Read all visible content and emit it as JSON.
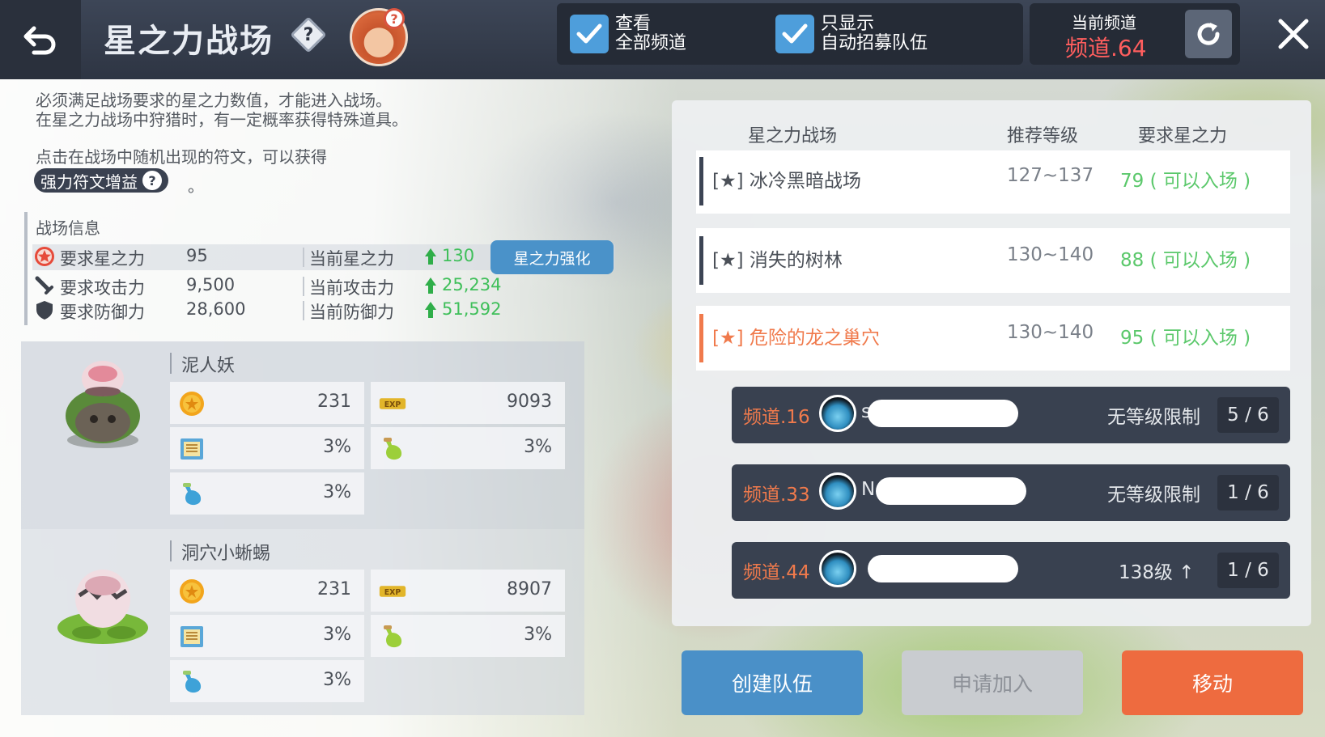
{
  "header": {
    "title": "星之力战场",
    "help_mark": "?",
    "mascot_badge": "?",
    "filter_all_line1": "查看",
    "filter_all_line2": "全部频道",
    "filter_recruit_line1": "只显示",
    "filter_recruit_line2": "自动招募队伍",
    "current_channel_caption": "当前频道",
    "current_channel_value": "频道.64",
    "filter_all_checked": true,
    "filter_recruit_checked": true
  },
  "info": {
    "desc_line1": "必须满足战场要求的星之力数值，才能进入战场。",
    "desc_line2": "在星之力战场中狩猎时，有一定概率获得特殊道具。",
    "rune_line": "点击在战场中随机出现的符文，可以获得",
    "rune_pill": "强力符文增益",
    "rune_pill_q": "?",
    "rune_end": "。"
  },
  "battle_info": {
    "title": "战场信息",
    "stats": [
      {
        "icon": "star-force-icon",
        "label": "要求星之力",
        "required": "95",
        "current_label": "当前星之力",
        "current": "130"
      },
      {
        "icon": "sword-icon",
        "label": "要求攻击力",
        "required": "9,500",
        "current_label": "当前攻击力",
        "current": "25,234"
      },
      {
        "icon": "shield-icon",
        "label": "要求防御力",
        "required": "28,600",
        "current_label": "当前防御力",
        "current": "51,592"
      }
    ],
    "enhance_button": "星之力强化"
  },
  "monsters": [
    {
      "name": "泥人妖",
      "drops": [
        {
          "icon": "meso-coin-icon",
          "value": "231"
        },
        {
          "icon": "exp-icon",
          "value": "9093"
        },
        {
          "icon": "scroll-icon",
          "value": "3%"
        },
        {
          "icon": "potion-green-icon",
          "value": "3%"
        },
        {
          "icon": "potion-blue-icon",
          "value": "3%"
        }
      ]
    },
    {
      "name": "洞穴小蜥蜴",
      "drops": [
        {
          "icon": "meso-coin-icon",
          "value": "231"
        },
        {
          "icon": "exp-icon",
          "value": "8907"
        },
        {
          "icon": "scroll-icon",
          "value": "3%"
        },
        {
          "icon": "potion-green-icon",
          "value": "3%"
        },
        {
          "icon": "potion-blue-icon",
          "value": "3%"
        }
      ]
    }
  ],
  "battlefields": {
    "headers": [
      "星之力战场",
      "推荐等级",
      "要求星之力"
    ],
    "rows": [
      {
        "name": "[★] 冰冷黑暗战场",
        "level": "127~137",
        "requirement": "79 ( 可以入场 )",
        "selected": false
      },
      {
        "name": "[★] 消失的树林",
        "level": "130~140",
        "requirement": "88 ( 可以入场 )",
        "selected": false
      },
      {
        "name": "[★] 危险的龙之巢穴",
        "level": "130~140",
        "requirement": "95 ( 可以入场 )",
        "selected": true
      }
    ]
  },
  "teams": [
    {
      "channel": "频道.16",
      "name_visible": "s",
      "level": "无等级限制",
      "count": "5 / 6"
    },
    {
      "channel": "频道.33",
      "name_visible": "N",
      "level": "无等级限制",
      "count": "1 / 6"
    },
    {
      "channel": "频道.44",
      "name_visible": "",
      "level": "138级 ↑",
      "count": "1 / 6"
    }
  ],
  "buttons": {
    "create": "创建队伍",
    "apply": "申请加入",
    "move": "移动"
  },
  "colors": {
    "accent_orange": "#ee6b3f",
    "accent_blue": "#4a90c8",
    "ok_green": "#5bc86b",
    "channel_red": "#ff5e5e"
  }
}
